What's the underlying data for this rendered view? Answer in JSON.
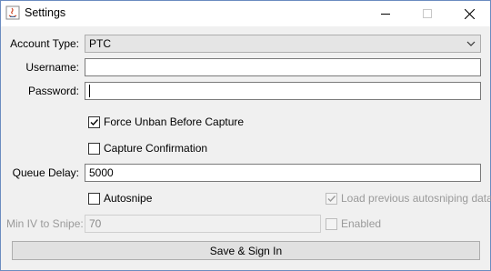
{
  "window": {
    "title": "Settings",
    "minimize_icon": "minimize-icon",
    "maximize_icon": "maximize-icon",
    "close_icon": "close-icon"
  },
  "form": {
    "account_type": {
      "label": "Account Type:",
      "value": "PTC"
    },
    "username": {
      "label": "Username:",
      "value": ""
    },
    "password": {
      "label": "Password:",
      "value": ""
    },
    "force_unban": {
      "label": "Force Unban Before Capture",
      "checked": true
    },
    "capture_confirmation": {
      "label": "Capture Confirmation",
      "checked": false
    },
    "queue_delay": {
      "label": "Queue Delay:",
      "value": "5000"
    },
    "autosnipe": {
      "label": "Autosnipe",
      "checked": false
    },
    "load_previous": {
      "label": "Load previous autosniping data",
      "checked": true,
      "enabled": false
    },
    "min_iv": {
      "label": "Min IV to Snipe:",
      "value": "70",
      "enabled": false
    },
    "enabled": {
      "label": "Enabled",
      "checked": false,
      "enabled": false
    },
    "save_button": {
      "label": "Save & Sign In"
    }
  }
}
